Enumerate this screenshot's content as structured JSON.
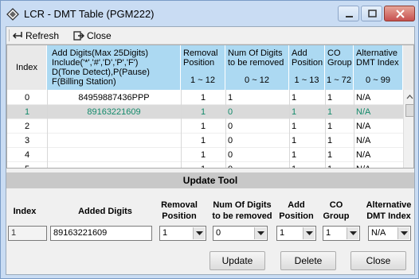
{
  "window": {
    "title": "LCR - DMT Table (PGM222)"
  },
  "toolbar": {
    "refresh_label": "Refresh",
    "close_label": "Close"
  },
  "table": {
    "headers": {
      "index": "Index",
      "add_digits": "Add Digits(Max 25Digits)\nInclude('*','#','D','P','F')\nD(Tone Detect),P(Pause)\nF(Billing Station)",
      "removal_position": "Removal\nPosition",
      "removal_position_range": "1 ~ 12",
      "num_digits_removed": "Num Of Digits\nto be removed",
      "num_digits_removed_range": "0 ~ 12",
      "add_position": "Add\nPosition",
      "add_position_range": "1 ~ 13",
      "co_group": "CO\nGroup",
      "co_group_range": "1 ~ 72",
      "alt_dmt_index": "Alternative\nDMT Index",
      "alt_dmt_index_range": "0 ~ 99"
    },
    "rows": [
      {
        "index": "0",
        "add_digits": "84959887436PPP",
        "removal_position": "1",
        "num_removed": "1",
        "add_position": "1",
        "co_group": "1",
        "alt_dmt": "N/A"
      },
      {
        "index": "1",
        "add_digits": "89163221609",
        "removal_position": "1",
        "num_removed": "0",
        "add_position": "1",
        "co_group": "1",
        "alt_dmt": "N/A"
      },
      {
        "index": "2",
        "add_digits": "",
        "removal_position": "1",
        "num_removed": "0",
        "add_position": "1",
        "co_group": "1",
        "alt_dmt": "N/A"
      },
      {
        "index": "3",
        "add_digits": "",
        "removal_position": "1",
        "num_removed": "0",
        "add_position": "1",
        "co_group": "1",
        "alt_dmt": "N/A"
      },
      {
        "index": "4",
        "add_digits": "",
        "removal_position": "1",
        "num_removed": "0",
        "add_position": "1",
        "co_group": "1",
        "alt_dmt": "N/A"
      },
      {
        "index": "5",
        "add_digits": "",
        "removal_position": "1",
        "num_removed": "0",
        "add_position": "1",
        "co_group": "1",
        "alt_dmt": "N/A"
      }
    ]
  },
  "update_tool": {
    "title": "Update Tool",
    "labels": {
      "index": "Index",
      "added_digits": "Added Digits",
      "removal_position": "Removal\nPosition",
      "num_removed": "Num Of Digits\nto be removed",
      "add_position": "Add\nPosition",
      "co_group": "CO\nGroup",
      "alt_dmt": "Alternative\nDMT Index"
    },
    "values": {
      "index": "1",
      "added_digits": "89163221609",
      "removal_position": "1",
      "num_removed": "0",
      "add_position": "1",
      "co_group": "1",
      "alt_dmt": "N/A"
    },
    "buttons": {
      "update": "Update",
      "delete": "Delete",
      "close": "Close"
    }
  },
  "colors": {
    "header_blue": "#acd9f2",
    "selected_text": "#138a6b",
    "window_frame": "#c9dcf3"
  }
}
